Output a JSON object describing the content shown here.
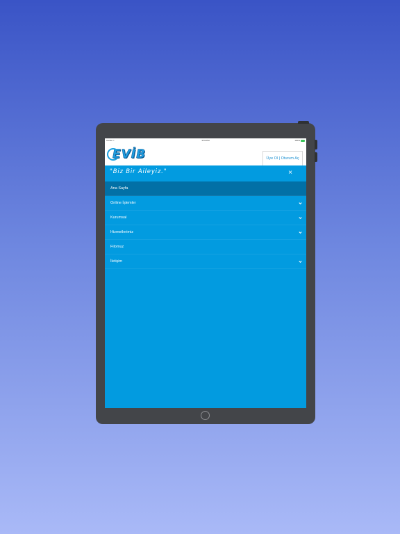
{
  "status_bar": {
    "carrier": "Carrier  ▿",
    "time": "3:59 PM",
    "battery": "100%"
  },
  "header": {
    "logo_text": "EVİB",
    "login_button": "Üye Ol | Oturum Aç"
  },
  "menu": {
    "slogan": "\"Biz Bir Aileyiz.\"",
    "close_label": "×",
    "items": [
      {
        "label": "Ana Sayfa",
        "active": true,
        "has_submenu": false
      },
      {
        "label": "Online İşlemler",
        "active": false,
        "has_submenu": true
      },
      {
        "label": "Kurumsal",
        "active": false,
        "has_submenu": true
      },
      {
        "label": "Hizmetlerimiz",
        "active": false,
        "has_submenu": true
      },
      {
        "label": "Filomuz",
        "active": false,
        "has_submenu": false
      },
      {
        "label": "İletişim",
        "active": false,
        "has_submenu": true
      }
    ]
  },
  "colors": {
    "menu_background": "#029be0",
    "active_item": "#0270a6",
    "brand_blue": "#1f9fe3"
  },
  "icons": {
    "chevron": "chevron-down-icon",
    "close": "close-icon",
    "home": "home-button-icon"
  }
}
